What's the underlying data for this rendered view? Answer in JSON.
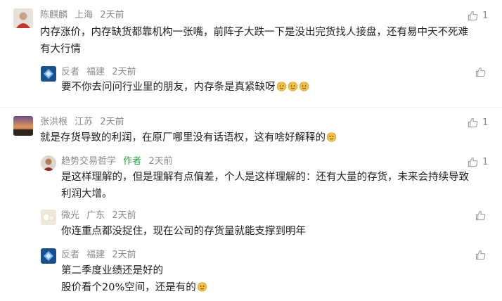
{
  "comments": [
    {
      "user": "陈麒麟",
      "location": "上海",
      "time": "2天前",
      "likes": "1",
      "lines": [
        "内存涨价，内存缺货都靠机构一张嘴，前阵子大跌一下是没出完货找人接盘，还有易中天不死难",
        "有大行情"
      ]
    },
    {
      "user": "反者",
      "location": "福建",
      "time": "2天前",
      "likes": "",
      "lines": [
        "要不你去问问行业里的朋友，内存条是真紧缺呀"
      ]
    },
    {
      "user": "张洪根",
      "location": "江苏",
      "time": "2天前",
      "likes": "1",
      "lines": [
        "就是存货导致的利润，在原厂哪里没有话语权，这有啥好解释的"
      ]
    },
    {
      "user": "趋势交易哲学",
      "badge": "作者",
      "location": "",
      "time": "2天前",
      "likes": "1",
      "lines": [
        "是这样理解的，但是理解有点偏差，个人是这样理解的：还有大量的存货，未来会持续导致",
        "利润大增。"
      ]
    },
    {
      "user": "微光",
      "location": "广东",
      "time": "2天前",
      "likes": "",
      "lines": [
        "你连重点都没捉住，现在公司的存货量就能支撑到明年"
      ]
    },
    {
      "user": "反者",
      "location": "福建",
      "time": "2天前",
      "likes": "",
      "lines": [
        "第二季度业绩还是好的",
        "股价看个20%空间，还是有的"
      ]
    }
  ],
  "icons": {
    "like": "thumbs-up-icon",
    "emoji": "doge-emoji-icon"
  },
  "colors": {
    "meta_text": "#8a8a8a",
    "author_badge": "#2a9d3f",
    "body_text": "#222222"
  }
}
